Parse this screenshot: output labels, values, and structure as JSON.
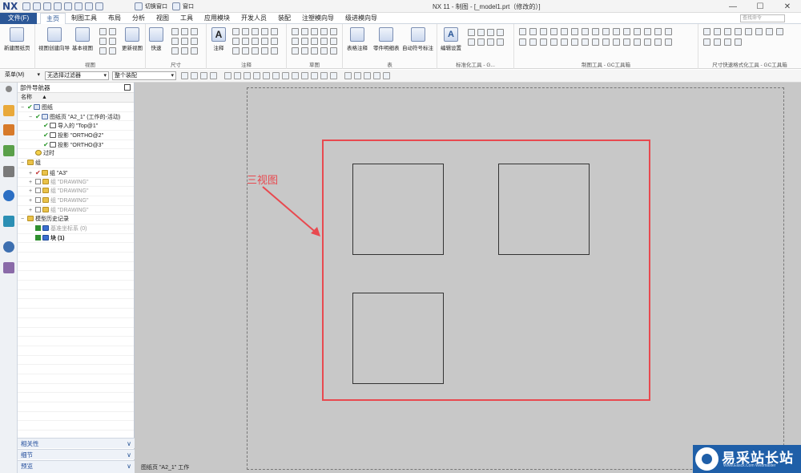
{
  "titlebar": {
    "app_logo": "NX",
    "switch_window": "切换窗口",
    "window_menu": "窗口",
    "title": "NX 11 - 制图 - [_model1.prt（修改的）]"
  },
  "menubar": {
    "file": "文件(F)",
    "tabs": [
      "主页",
      "制图工具",
      "布局",
      "分析",
      "视图",
      "工具",
      "应用模块",
      "开发人员",
      "装配",
      "注塑模向导",
      "级进模向导"
    ],
    "active_tab": "主页",
    "search_placeholder": "查找命令"
  },
  "ribbon": {
    "groups": [
      {
        "label": "",
        "buttons": [
          "新建图纸页"
        ]
      },
      {
        "label": "视图",
        "buttons": [
          "视图创建向导",
          "基本视图",
          "更新视图"
        ]
      },
      {
        "label": "尺寸",
        "buttons": [
          "快速"
        ]
      },
      {
        "label": "注释",
        "buttons": [
          "注释"
        ]
      },
      {
        "label": "草图",
        "buttons": []
      },
      {
        "label": "表",
        "buttons": [
          "表格注释",
          "零件明细表",
          "自动符号标注"
        ]
      },
      {
        "label": "标准化工具 - G...",
        "buttons": [
          "编辑设置"
        ]
      },
      {
        "label": "制图工具 - GC工具箱",
        "buttons": []
      },
      {
        "label": "尺寸快速格式化工具 - GC工具箱",
        "buttons": []
      }
    ]
  },
  "toolbar2": {
    "menu": "菜单(M)",
    "filter": "无选择过滤器",
    "scope": "整个装配"
  },
  "navigator": {
    "title": "部件导航器",
    "column": "名称",
    "rows": [
      {
        "text": "图纸",
        "level": 0,
        "exp": "−",
        "icon": "sheet",
        "tick": true
      },
      {
        "text": "图纸页 \"A2_1\" (工作的-活动)",
        "level": 1,
        "exp": "−",
        "icon": "sheet",
        "tick": true
      },
      {
        "text": "导入的 \"Top@1\"",
        "level": 2,
        "exp": "",
        "icon": "view",
        "tick": true
      },
      {
        "text": "投影 \"ORTHO@2\"",
        "level": 2,
        "exp": "",
        "icon": "view",
        "tick": true
      },
      {
        "text": "投影 \"ORTHO@3\"",
        "level": 2,
        "exp": "",
        "icon": "view",
        "tick": true
      },
      {
        "text": "过时",
        "level": 1,
        "exp": "",
        "icon": "clock",
        "tick": false
      },
      {
        "text": "组",
        "level": 0,
        "exp": "−",
        "icon": "folder",
        "tick": false
      },
      {
        "text": "组 \"A3\"",
        "level": 1,
        "exp": "+",
        "icon": "folder",
        "tick": true,
        "red": true
      },
      {
        "text": "组 \"DRAWING\"",
        "level": 1,
        "exp": "+",
        "icon": "folder",
        "gray": true,
        "box": true
      },
      {
        "text": "组 \"DRAWING\"",
        "level": 1,
        "exp": "+",
        "icon": "folder",
        "gray": true,
        "box": true
      },
      {
        "text": "组 \"DRAWING\"",
        "level": 1,
        "exp": "+",
        "icon": "folder",
        "gray": true,
        "box": true
      },
      {
        "text": "组 \"DRAWING\"",
        "level": 1,
        "exp": "+",
        "icon": "folder",
        "gray": true,
        "box": true
      },
      {
        "text": "模型历史记录",
        "level": 0,
        "exp": "−",
        "icon": "folder",
        "tick": false
      },
      {
        "text": "基准坐标系 (0)",
        "level": 1,
        "exp": "",
        "icon": "block",
        "gray": true,
        "checkbox": true
      },
      {
        "text": "块 (1)",
        "level": 1,
        "exp": "",
        "icon": "block",
        "bold": true,
        "checkbox": true
      }
    ],
    "accordions": [
      "相关性",
      "细节",
      "预览"
    ]
  },
  "canvas": {
    "annotation": "三视图",
    "status": "图纸页 \"A2_1\" 工作"
  },
  "watermark": {
    "text": "易采站长站",
    "sub": "Www.Easck.Com Webmaster"
  },
  "colors": {
    "accent": "#2b5797",
    "frame_red": "#e8494f",
    "canvas_bg": "#c8c8c8",
    "tick_green": "#2f9a2f"
  }
}
